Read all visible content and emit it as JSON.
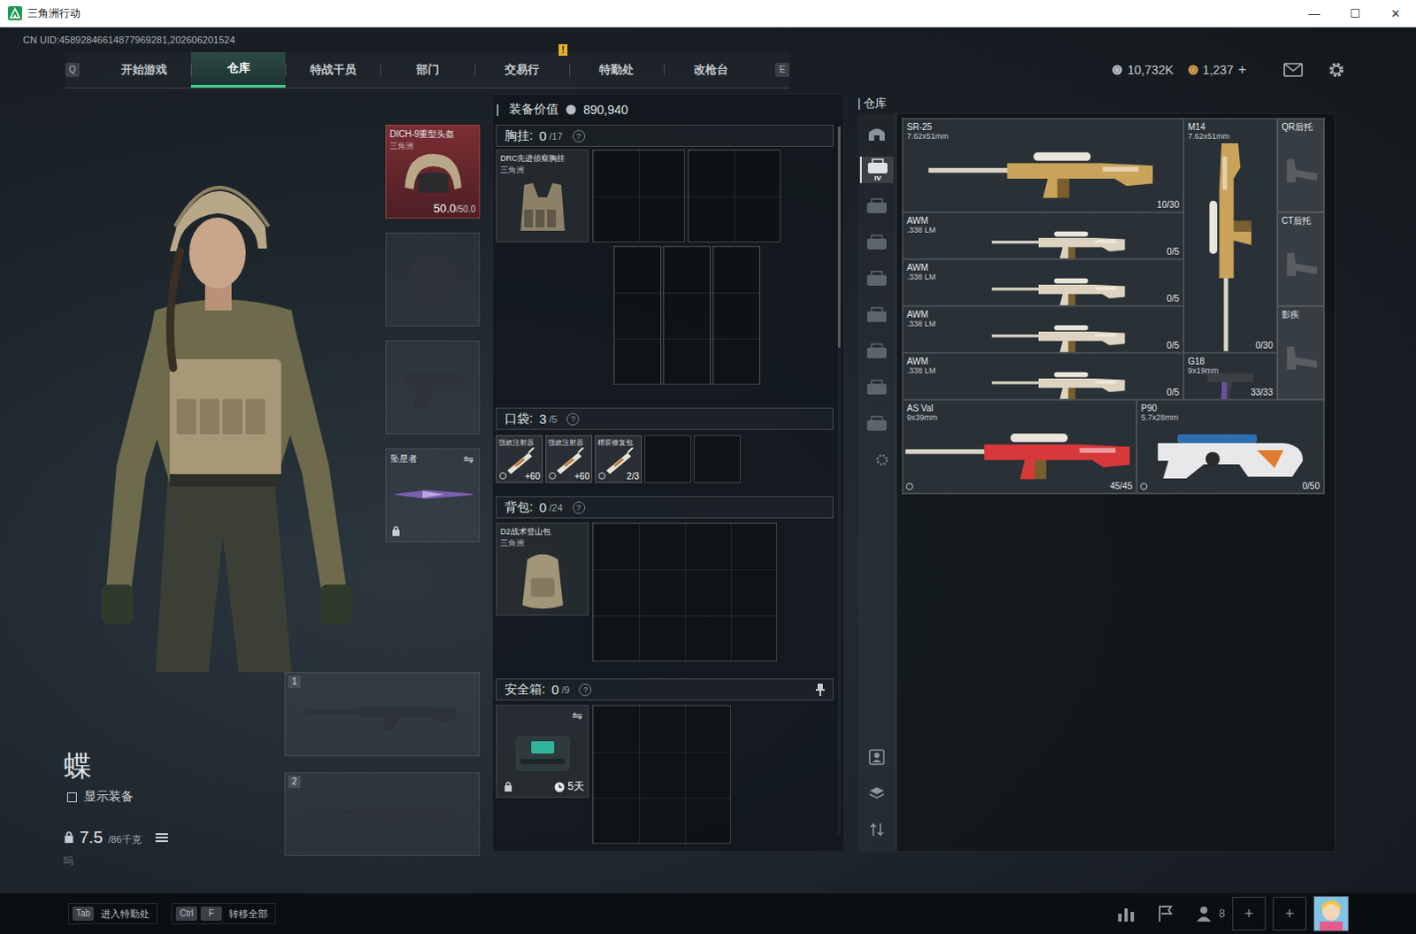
{
  "window": {
    "title": "三角洲行动",
    "controls": [
      "—",
      "☐",
      "✕"
    ]
  },
  "uid": "CN UID:45892846614877969281,202606201524",
  "nav": {
    "left_key": "Q",
    "right_key": "E",
    "alert_mark": "!",
    "tabs": [
      {
        "label": "开始游戏",
        "selected": false,
        "alert": false
      },
      {
        "label": "仓库",
        "selected": true,
        "alert": false
      },
      {
        "label": "特战干员",
        "selected": false,
        "alert": false
      },
      {
        "label": "部门",
        "selected": false,
        "alert": false
      },
      {
        "label": "交易行",
        "selected": false,
        "alert": true
      },
      {
        "label": "特勤处",
        "selected": false,
        "alert": false
      },
      {
        "label": "改枪台",
        "selected": false,
        "alert": false
      }
    ]
  },
  "currency": [
    {
      "amount": "10,732K",
      "color": "#b8bec4",
      "add": ""
    },
    {
      "amount": "1,237",
      "color": "#d4a24a",
      "add": "+"
    }
  ],
  "operator": {
    "name": "蝶",
    "show_gear": {
      "label": "显示装备",
      "checked": false
    },
    "weight": "7.5",
    "weight_max": "/86千克",
    "note": "吗"
  },
  "gear_slots": [
    {
      "kind": "helmet",
      "filled": true,
      "name": "DICH-9重型头盔",
      "brand": "三角洲",
      "reading": "50.0",
      "reading_max": "/50.0"
    },
    {
      "kind": "armor",
      "filled": false
    },
    {
      "kind": "pistol",
      "filled": false
    },
    {
      "kind": "melee",
      "filled": true,
      "name": "坠星者",
      "swap": "⇋",
      "locked": true
    }
  ],
  "weapon_slots": [
    {
      "number": "1",
      "filled": false
    },
    {
      "number": "2",
      "filled": false
    }
  ],
  "loadout": {
    "value_label": "装备价值",
    "value": "890,940",
    "chest_rig": {
      "label": "胸挂:",
      "count": "0",
      "capacity": "/17",
      "help": "?",
      "item": {
        "name": "DRC先进侦察胸挂",
        "brand": "三角洲"
      }
    },
    "pockets": {
      "label": "口袋:",
      "count": "3",
      "capacity": "/5",
      "help": "?",
      "slots": [
        {
          "filled": true,
          "name": "强效注射器",
          "value": "+60",
          "bound": true
        },
        {
          "filled": true,
          "name": "强效注射器",
          "value": "+60",
          "bound": true
        },
        {
          "filled": true,
          "name": "精装修复包",
          "value": "2/3",
          "bound": true
        },
        {
          "filled": false
        },
        {
          "filled": false
        }
      ]
    },
    "backpack": {
      "label": "背包:",
      "count": "0",
      "capacity": "/24",
      "help": "?",
      "item": {
        "name": "D2战术登山包",
        "brand": "三角洲"
      }
    },
    "safe_box": {
      "label": "安全箱:",
      "count": "0",
      "capacity": "/9",
      "help": "?",
      "pinned": true,
      "swap": "⇋",
      "locked": true,
      "time_left": "5天"
    }
  },
  "warehouse": {
    "title": "仓库",
    "sidebar": [
      {
        "kind": "home",
        "label": "",
        "selected": false
      },
      {
        "kind": "tier",
        "label": "IV",
        "selected": true
      },
      {
        "kind": "tier",
        "label": "",
        "selected": false
      },
      {
        "kind": "tier",
        "label": "",
        "selected": false
      },
      {
        "kind": "tier",
        "label": "",
        "selected": false
      },
      {
        "kind": "tier",
        "label": "",
        "selected": false
      },
      {
        "kind": "tier",
        "label": "",
        "selected": false
      },
      {
        "kind": "tier",
        "label": "",
        "selected": false
      },
      {
        "kind": "tier",
        "label": "",
        "selected": false
      },
      {
        "kind": "settings",
        "label": "",
        "selected": false
      }
    ],
    "sidebar_bottom": [
      {
        "kind": "operator"
      },
      {
        "kind": "layers"
      },
      {
        "kind": "sort"
      }
    ],
    "items": [
      {
        "kind": "rifle",
        "name": "SR-25",
        "caliber": "7.62x51mm",
        "ammo": "10/30",
        "color": "#c9a35a",
        "bound": false
      },
      {
        "kind": "rifle",
        "name": "M14",
        "caliber": "7.62x51mm",
        "ammo": "0/30",
        "color": "#c9a35a",
        "bound": false
      },
      {
        "kind": "stock",
        "name": "QR后托",
        "color": "#5a5e62",
        "bound": false
      },
      {
        "kind": "sniper",
        "name": "AWM",
        "caliber": ".338 LM",
        "ammo": "0/5",
        "color": "#ddd3c0",
        "bound": false
      },
      {
        "kind": "sniper",
        "name": "AWM",
        "caliber": ".338 LM",
        "ammo": "0/5",
        "color": "#ddd3c0",
        "bound": false
      },
      {
        "kind": "sniper",
        "name": "AWM",
        "caliber": ".338 LM",
        "ammo": "0/5",
        "color": "#ddd3c0",
        "bound": false
      },
      {
        "kind": "sniper",
        "name": "AWM",
        "caliber": ".338 LM",
        "ammo": "0/5",
        "color": "#ddd3c0",
        "bound": false
      },
      {
        "kind": "stock",
        "name": "CT后托",
        "color": "#5a5e62",
        "bound": false
      },
      {
        "kind": "stock",
        "name": "影疾",
        "color": "#5a5e62",
        "bound": false
      },
      {
        "kind": "pistol",
        "name": "G18",
        "caliber": "9x19mm",
        "ammo": "33/33",
        "color": "#6a4fa0",
        "bound": false
      },
      {
        "kind": "rifle",
        "name": "AS Val",
        "caliber": "9x39mm",
        "ammo": "45/45",
        "color": "#d8383a",
        "bound": true
      },
      {
        "kind": "smg",
        "name": "P90",
        "caliber": "5.7x28mm",
        "ammo": "0/50",
        "color": "#e8e8ea",
        "bound": true
      }
    ]
  },
  "footer": {
    "hints": [
      {
        "keys": [
          "Tab"
        ],
        "label": "进入特勤处"
      },
      {
        "keys": [
          "Ctrl",
          "F"
        ],
        "label": "转移全部"
      }
    ],
    "friends": "8",
    "add_slots": [
      "+",
      "+"
    ]
  }
}
